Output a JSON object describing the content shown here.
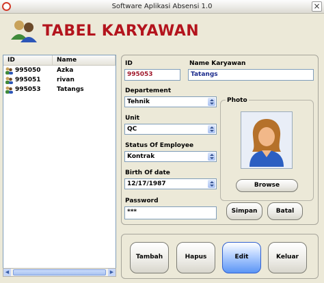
{
  "window": {
    "title": "Software Aplikasi Absensi 1.0",
    "close_glyph": "×"
  },
  "header": {
    "title": "TABEL KARYAWAN",
    "icon": "users-icon"
  },
  "list": {
    "columns": [
      "ID",
      "Name"
    ],
    "rows": [
      {
        "id": "995050",
        "name": "Azka"
      },
      {
        "id": "995051",
        "name": "rivan"
      },
      {
        "id": "995053",
        "name": "Tatangs"
      }
    ]
  },
  "form": {
    "id_label": "ID",
    "id_value": "995053",
    "name_label": "Name Karyawan",
    "name_value": "Tatangs",
    "dept_label": "Departement",
    "dept_value": "Tehnik",
    "unit_label": "Unit",
    "unit_value": "QC",
    "status_label": "Status Of Employee",
    "status_value": "Kontrak",
    "birth_label": "Birth Of date",
    "birth_value": "12/17/1987",
    "password_label": "Password",
    "password_value": "***",
    "photo_label": "Photo"
  },
  "buttons": {
    "browse": "Browse",
    "simpan": "Simpan",
    "batal": "Batal",
    "tambah": "Tambah",
    "hapus": "Hapus",
    "edit": "Edit",
    "keluar": "Keluar"
  },
  "colors": {
    "title_red": "#b3141d",
    "id_red": "#a0182a",
    "name_blue": "#1a2a8c"
  }
}
